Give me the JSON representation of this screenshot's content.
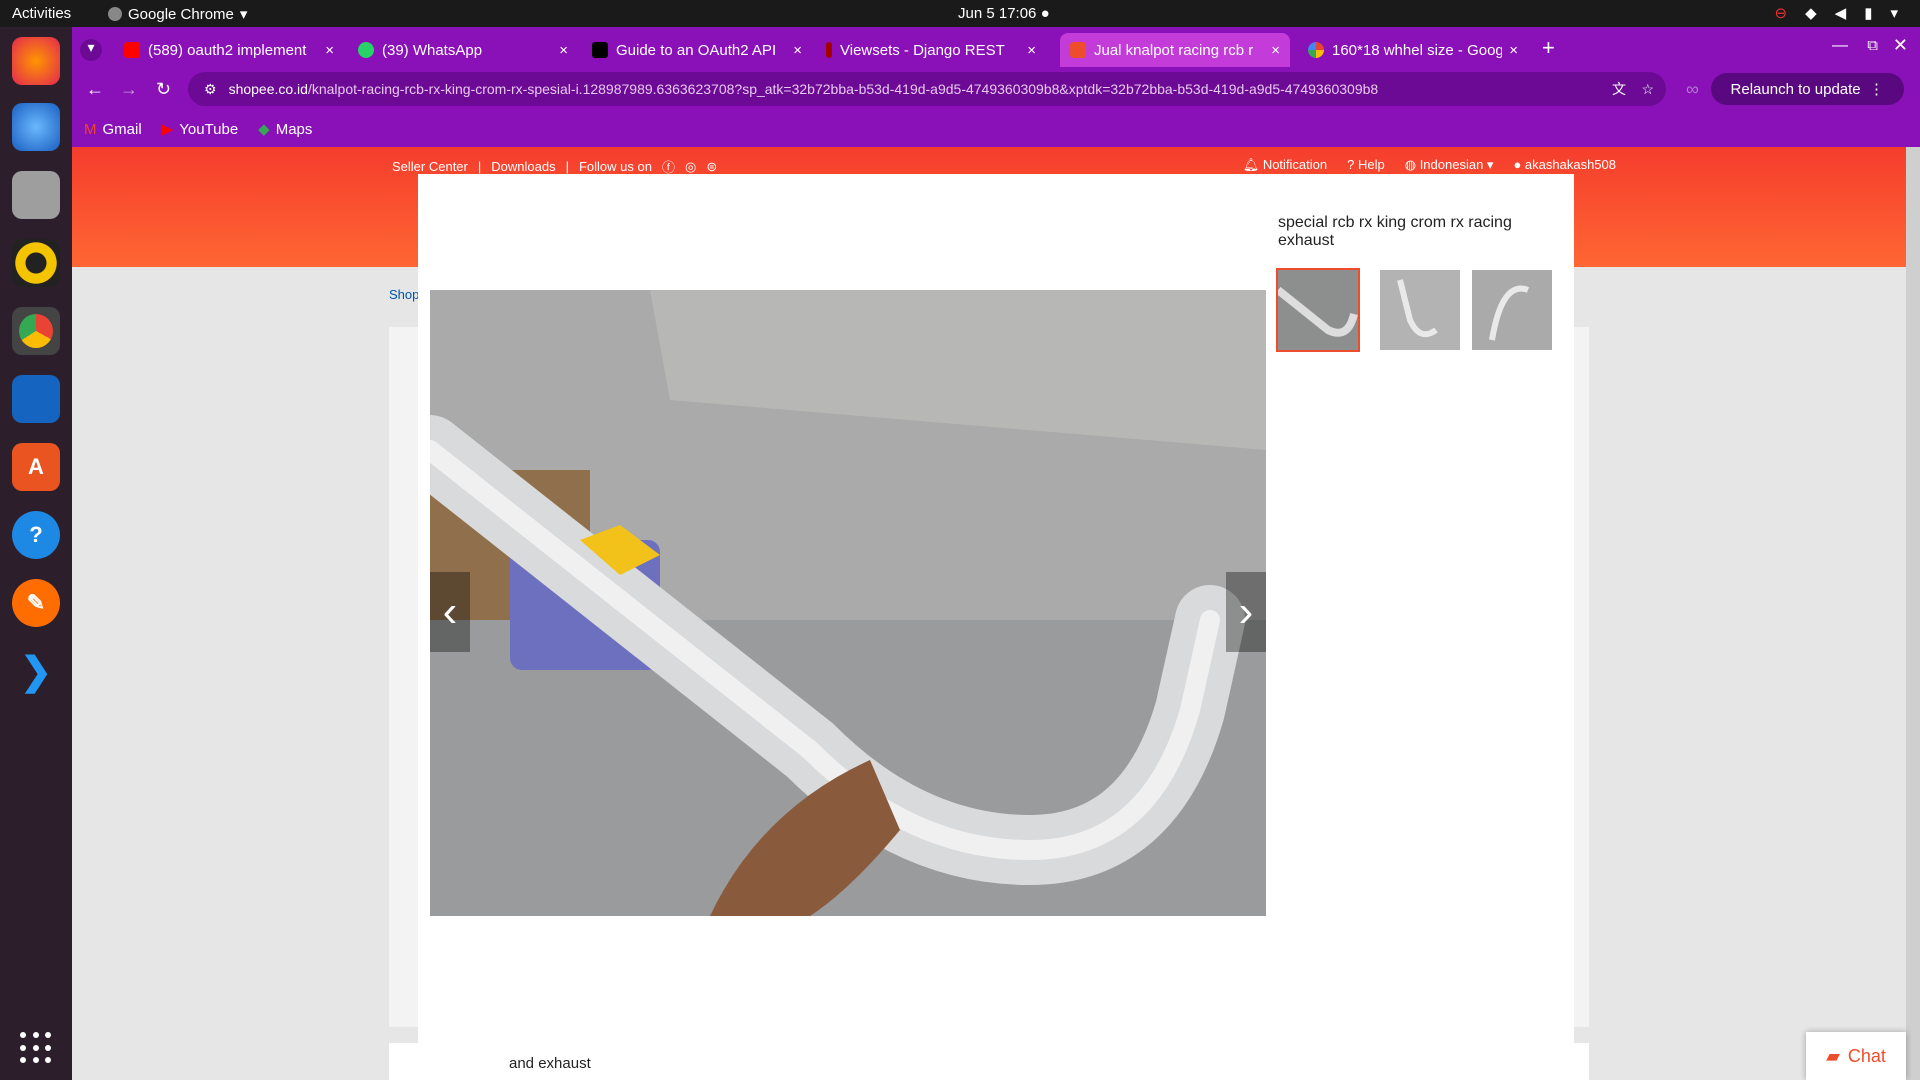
{
  "os": {
    "activities": "Activities",
    "app_name": "Google Chrome",
    "clock": "Jun 5  17:06"
  },
  "tabs": [
    {
      "title": "(589) oauth2 implement",
      "color": "#ff0000"
    },
    {
      "title": "(39) WhatsApp",
      "color": "#25d366"
    },
    {
      "title": "Guide to an OAuth2 API",
      "color": "#000000"
    },
    {
      "title": "Viewsets - Django REST",
      "color": "#a30000"
    },
    {
      "title": "Jual knalpot racing rcb r",
      "color": "#ee4d2d"
    },
    {
      "title": "160*18 whhel size - Goog",
      "color": "#4285f4"
    }
  ],
  "address": {
    "domain": "shopee.co.id",
    "path": "/knalpot-racing-rcb-rx-king-crom-rx-spesial-i.128987989.6363623708?sp_atk=32b72bba-b53d-419d-a9d5-4749360309b8&xptdk=32b72bba-b53d-419d-a9d5-4749360309b8",
    "relaunch": "Relaunch to update"
  },
  "bookmarks": [
    "Gmail",
    "YouTube",
    "Maps"
  ],
  "shopee": {
    "seller_center": "Seller Center",
    "downloads": "Downloads",
    "follow": "Follow us on",
    "notification": "Notification",
    "help": "Help",
    "language": "Indonesian",
    "user": "akashakash508",
    "shop_crumb": "Shop",
    "below_text": "and exhaust"
  },
  "modal": {
    "title": "special rcb rx king crom rx racing exhaust"
  },
  "chat": "Chat",
  "colors": {
    "chrome_purple": "#8a10b8",
    "shopee_orange": "#ee4d2d"
  }
}
